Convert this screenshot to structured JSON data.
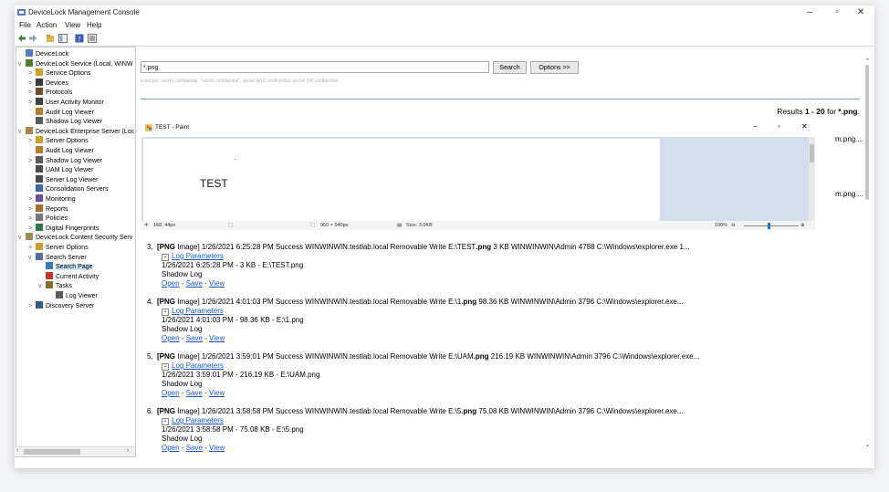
{
  "window": {
    "title": "DeviceLock Management Console",
    "controls": [
      "–",
      "▫",
      "✕"
    ]
  },
  "menu": [
    "File",
    "Action",
    "View",
    "Help"
  ],
  "tree": [
    {
      "label": "DeviceLock",
      "exp": "",
      "icon": "#5a7bbf"
    },
    {
      "label": "DeviceLock Service (Local, WINW",
      "exp": "v",
      "icon": "#4f7e3b"
    },
    {
      "label": "Service Options",
      "exp": ">",
      "icon": "#c9a227"
    },
    {
      "label": "Devices",
      "exp": ">",
      "icon": "#3b3b3b"
    },
    {
      "label": "Protocols",
      "exp": ">",
      "icon": "#6b4f2f"
    },
    {
      "label": "User Activity Monitor",
      "exp": ">",
      "icon": "#444"
    },
    {
      "label": "Audit Log Viewer",
      "exp": "",
      "icon": "#b07d2a"
    },
    {
      "label": "Shadow Log Viewer",
      "exp": "",
      "icon": "#5a5a5a"
    },
    {
      "label": "DeviceLock Enterprise Server (Loc",
      "exp": "v",
      "icon": "#a08955"
    },
    {
      "label": "Server Options",
      "exp": ">",
      "icon": "#c9a227"
    },
    {
      "label": "Audit Log Viewer",
      "exp": "",
      "icon": "#b07d2a"
    },
    {
      "label": "Shadow Log Viewer",
      "exp": ">",
      "icon": "#5a5a5a"
    },
    {
      "label": "UAM Log Viewer",
      "exp": "",
      "icon": "#4a4a4a"
    },
    {
      "label": "Server Log Viewer",
      "exp": "",
      "icon": "#4a4a4a"
    },
    {
      "label": "Consolidation Servers",
      "exp": "",
      "icon": "#3a66a8"
    },
    {
      "label": "Monitoring",
      "exp": ">",
      "icon": "#6c4e9e"
    },
    {
      "label": "Reports",
      "exp": ">",
      "icon": "#a66b2d"
    },
    {
      "label": "Policies",
      "exp": ">",
      "icon": "#777"
    },
    {
      "label": "Digital Fingerprints",
      "exp": ">",
      "icon": "#2d7a4d"
    },
    {
      "label": "DeviceLock Content Security Serv",
      "exp": "v",
      "icon": "#a08955"
    },
    {
      "label": "Server Options",
      "exp": ">",
      "icon": "#c9a227"
    },
    {
      "label": "Search Server",
      "exp": "v",
      "icon": "#4f6f9e"
    },
    {
      "label": "Search Page",
      "exp": "",
      "icon": "#3b78c2"
    },
    {
      "label": "Current Activity",
      "exp": "",
      "icon": "#c0392b"
    },
    {
      "label": "Tasks",
      "exp": "v",
      "icon": "#8a6d2c"
    },
    {
      "label": "Log Viewer",
      "exp": "",
      "icon": "#5a5a5a"
    },
    {
      "label": "Discovery Server",
      "exp": ">",
      "icon": "#3b5a8c"
    }
  ],
  "search": {
    "value": "*.png",
    "search_label": "Search",
    "options_label": "Options >>",
    "hint": "Example: secret confidential, \"secret confidential\", secret AND confidential, secret OR confidential"
  },
  "results_summary": {
    "prefix": "Results ",
    "range": "1 - 20",
    "for": " for ",
    "query": "*.png",
    "suffix": "."
  },
  "paint": {
    "title": "TEST - Paint",
    "canvas_text": "TEST",
    "status": {
      "position": "168, 44px",
      "size": "960 × 540px",
      "file_size": "Size: 3.0KB",
      "zoom": "100%"
    }
  },
  "behind_rows": [
    "m.png ...",
    "m.png ..."
  ],
  "results": [
    {
      "num": "3.",
      "pre": "[PNG",
      "post": " Image] 1/26/2021 6:25:28 PM Success WINWINWIN.testlab.local Removable Write E:\\TEST",
      "ext": ".png",
      "tail": " 3 KB WINWINWIN\\Admin 4788 C:\\Windows\\explorer.exe 1...",
      "log_params": "Log Parameters",
      "meta": "1/26/2021 6:25:28 PM - 3 KB - E:\\TEST.png",
      "log_type": "Shadow Log",
      "open": "Open",
      "save": "Save",
      "view": "View"
    },
    {
      "num": "4.",
      "pre": "[PNG",
      "post": " Image] 1/26/2021 4:01:03 PM Success WINWINWIN.testlab.local Removable Write E:\\1",
      "ext": ".png",
      "tail": " 98.36 KB WINWINWIN\\Admin 3796 C:\\Windows\\explorer.exe...",
      "log_params": "Log Parameters",
      "meta": "1/26/2021 4:01:03 PM - 98.36 KB - E:\\1.png",
      "log_type": "Shadow Log",
      "open": "Open",
      "save": "Save",
      "view": "View"
    },
    {
      "num": "5.",
      "pre": "[PNG",
      "post": " Image] 1/26/2021 3:59:01 PM Success WINWINWIN.testlab.local Removable Write E:\\UAM",
      "ext": ".png",
      "tail": " 216.19 KB WINWINWIN\\Admin 3796 C:\\Windows\\explorer.exe...",
      "log_params": "Log Parameters",
      "meta": "1/26/2021 3:59:01 PM - 216.19 KB - E:\\UAM.png",
      "log_type": "Shadow Log",
      "open": "Open",
      "save": "Save",
      "view": "View"
    },
    {
      "num": "6.",
      "pre": "[PNG",
      "post": " Image] 1/26/2021 3:58:58 PM Success WINWINWIN.testlab.local Removable Write E:\\5",
      "ext": ".png",
      "tail": " 75.08 KB WINWINWIN\\Admin 3796 C:\\Windows\\explorer.exe...",
      "log_params": "Log Parameters",
      "meta": "1/26/2021 3:58:58 PM - 75.08 KB - E:\\5.png",
      "log_type": "Shadow Log",
      "open": "Open",
      "save": "Save",
      "view": "View"
    }
  ]
}
